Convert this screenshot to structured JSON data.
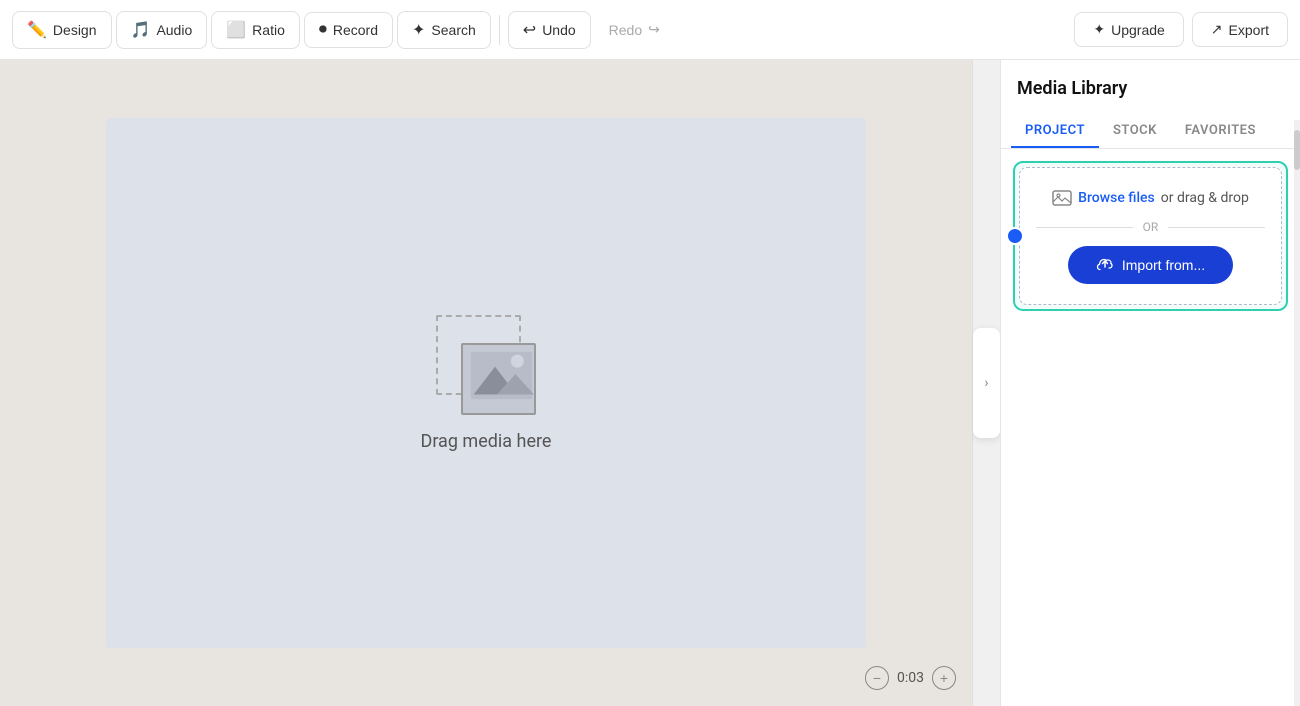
{
  "toolbar": {
    "design_label": "Design",
    "audio_label": "Audio",
    "ratio_label": "Ratio",
    "record_label": "Record",
    "search_label": "Search",
    "undo_label": "Undo",
    "redo_label": "Redo",
    "upgrade_label": "Upgrade",
    "export_label": "Export"
  },
  "canvas": {
    "drag_text": "Drag media here",
    "time_display": "0:03"
  },
  "media_library": {
    "title": "Media Library",
    "tabs": [
      {
        "id": "project",
        "label": "PROJECT",
        "active": true
      },
      {
        "id": "stock",
        "label": "STOCK",
        "active": false
      },
      {
        "id": "favorites",
        "label": "FAVORITES",
        "active": false
      }
    ],
    "upload": {
      "browse_text": "Browse files",
      "drag_text": "or drag & drop",
      "or_label": "OR",
      "import_label": "Import from..."
    }
  }
}
